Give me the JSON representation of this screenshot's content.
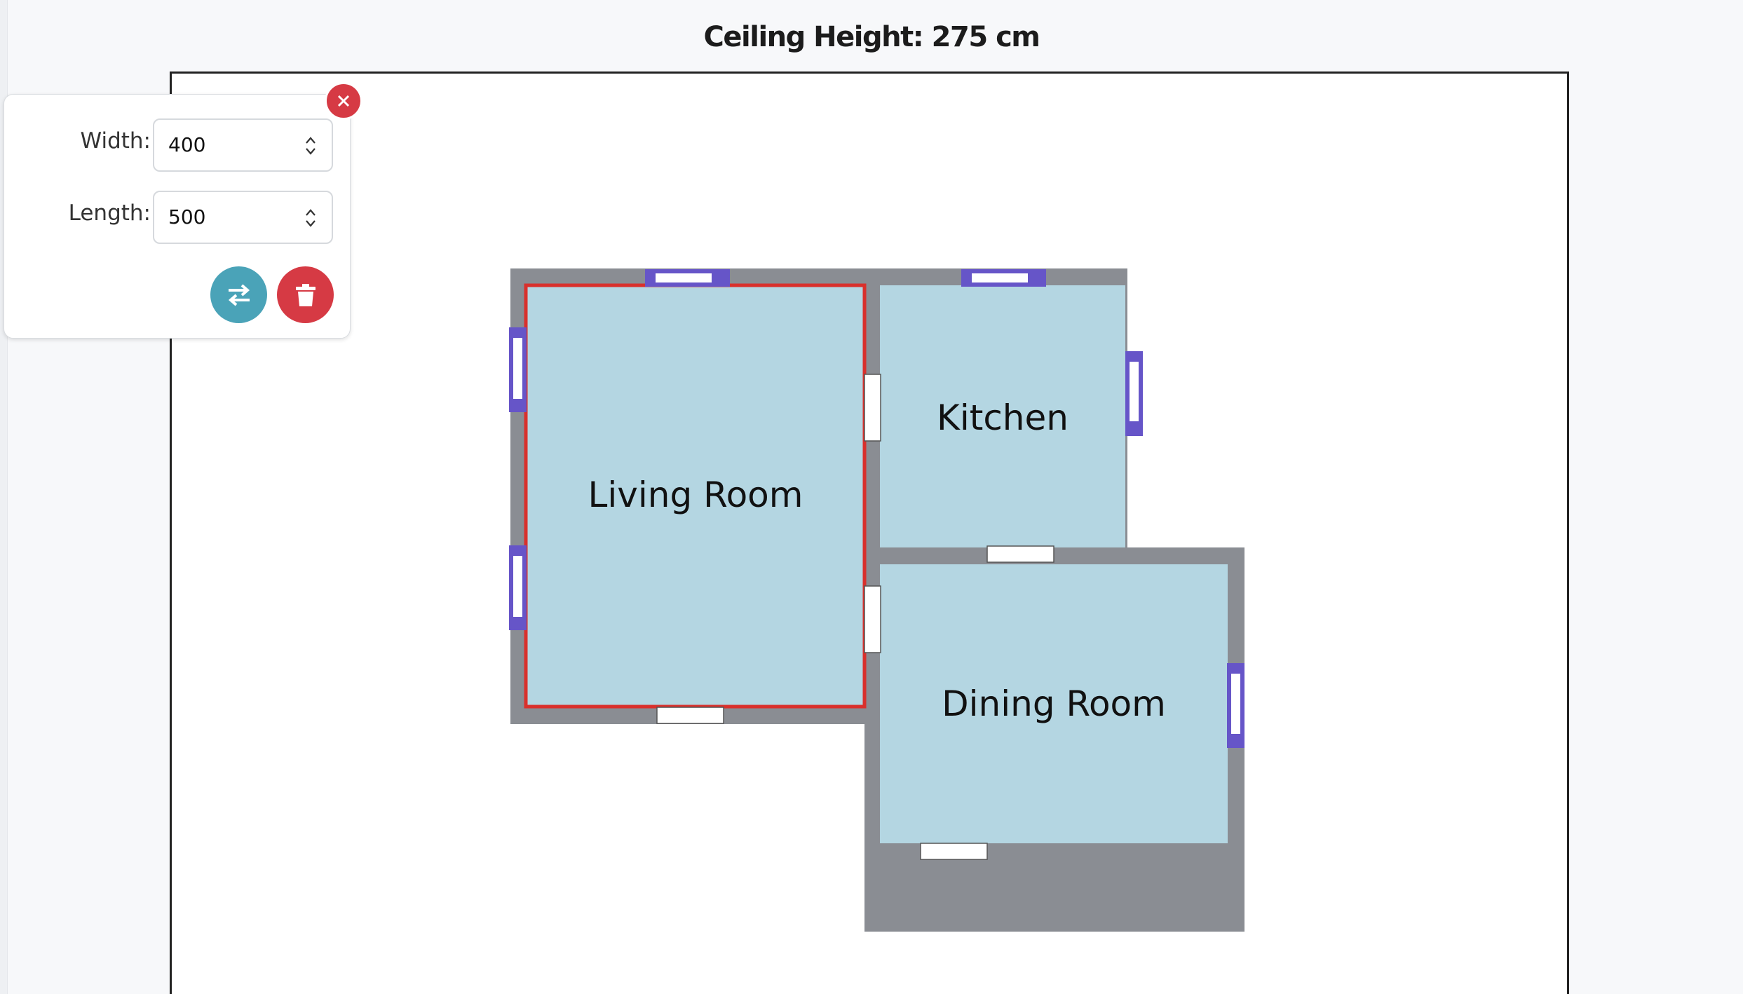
{
  "header": {
    "ceiling_label": "Ceiling Height: 275 cm"
  },
  "rooms": [
    {
      "name": "Living Room",
      "selected": true
    },
    {
      "name": "Kitchen",
      "selected": false
    },
    {
      "name": "Dining Room",
      "selected": false
    }
  ],
  "popup": {
    "width_label": "Width:",
    "width_value": "400",
    "length_label": "Length:",
    "length_value": "500"
  },
  "colors": {
    "room_fill": "#b4d6e2",
    "wall": "#8a8d93",
    "selection": "#d9302c",
    "window": "#6655c8",
    "door": "#ffffff",
    "swap_button": "#4aa3b8",
    "delete_button": "#d63a44"
  },
  "icons": {
    "close": "close-icon",
    "swap": "swap-icon",
    "delete": "trash-icon"
  }
}
